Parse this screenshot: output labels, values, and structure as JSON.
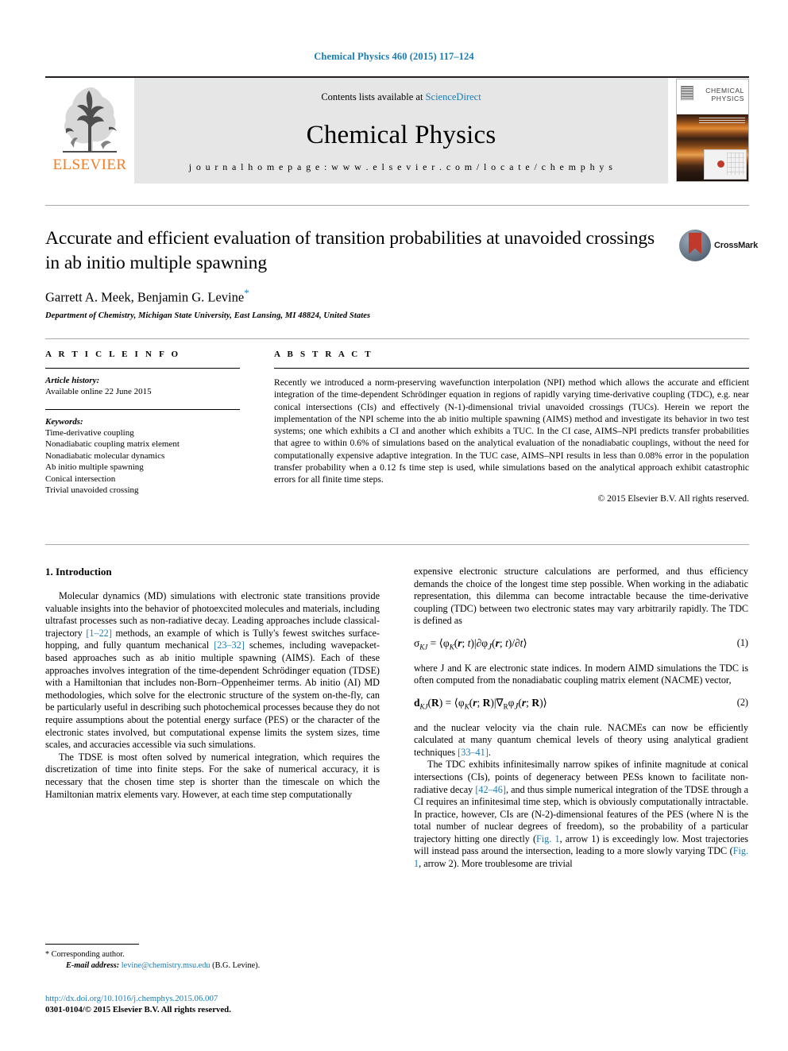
{
  "running_head": "Chemical Physics 460 (2015) 117–124",
  "masthead": {
    "publisher_logo_text": "ELSEVIER",
    "contents_prefix": "Contents lists available at ",
    "contents_link": "ScienceDirect",
    "journal_title": "Chemical Physics",
    "homepage_line": "j o u r n a l   h o m e p a g e :   w w w . e l s e v i e r . c o m / l o c a t e / c h e m p h y s",
    "cover_title_line1": "CHEMICAL",
    "cover_title_line2": "PHYSICS"
  },
  "article": {
    "title": "Accurate and efficient evaluation of transition probabilities at unavoided crossings in ab initio multiple spawning",
    "authors": "Garrett A. Meek, Benjamin G. Levine",
    "corresponding_marker": "*",
    "affiliation": "Department of Chemistry, Michigan State University, East Lansing, MI 48824, United States",
    "crossmark_label": "CrossMark"
  },
  "info": {
    "heading": "A R T I C L E   I N F O",
    "history_label": "Article history:",
    "history_value": "Available online 22 June 2015",
    "keywords_label": "Keywords:",
    "keywords": [
      "Time-derivative coupling",
      "Nonadiabatic coupling matrix element",
      "Nonadiabatic molecular dynamics",
      "Ab initio multiple spawning",
      "Conical intersection",
      "Trivial unavoided crossing"
    ]
  },
  "abstract": {
    "heading": "A B S T R A C T",
    "text": "Recently we introduced a norm-preserving wavefunction interpolation (NPI) method which allows the accurate and efficient integration of the time-dependent Schrödinger equation in regions of rapidly varying time-derivative coupling (TDC), e.g. near conical intersections (CIs) and effectively (N-1)-dimensional trivial unavoided crossings (TUCs). Herein we report the implementation of the NPI scheme into the ab initio multiple spawning (AIMS) method and investigate its behavior in two test systems; one which exhibits a CI and another which exhibits a TUC. In the CI case, AIMS–NPI predicts transfer probabilities that agree to within 0.6% of simulations based on the analytical evaluation of the nonadiabatic couplings, without the need for computationally expensive adaptive integration. In the TUC case, AIMS–NPI results in less than 0.08% error in the population transfer probability when a 0.12 fs time step is used, while simulations based on the analytical approach exhibit catastrophic errors for all finite time steps.",
    "copyright": "© 2015 Elsevier B.V. All rights reserved."
  },
  "body": {
    "section_heading": "1. Introduction",
    "left_paragraphs": [
      {
        "parts": [
          {
            "t": "Molecular dynamics (MD) simulations with electronic state transitions provide valuable insights into the behavior of photoexcited molecules and materials, including ultrafast processes such as non-radiative decay. Leading approaches include classical-trajectory "
          },
          {
            "t": "[1–22]",
            "ref": true
          },
          {
            "t": " methods, an example of which is Tully's fewest switches surface-hopping, and fully quantum mechanical "
          },
          {
            "t": "[23–32]",
            "ref": true
          },
          {
            "t": " schemes, including wavepacket-based approaches such as ab initio multiple spawning (AIMS). Each of these approaches involves integration of the time-dependent Schrödinger equation (TDSE) with a Hamiltonian that includes non-Born–Oppenheimer terms. Ab initio (AI) MD methodologies, which solve for the electronic structure of the system on-the-fly, can be particularly useful in describing such photochemical processes because they do not require assumptions about the potential energy surface (PES) or the character of the electronic states involved, but computational expense limits the system sizes, time scales, and accuracies accessible via such simulations."
          }
        ]
      },
      {
        "parts": [
          {
            "t": "The TDSE is most often solved by numerical integration, which requires the discretization of time into finite steps. For the sake of numerical accuracy, it is necessary that the chosen time step is shorter than the timescale on which the Hamiltonian matrix elements vary. However, at each time step computationally"
          }
        ]
      }
    ],
    "right_paragraphs": [
      {
        "parts": [
          {
            "t": "expensive electronic structure calculations are performed, and thus efficiency demands the choice of the longest time step possible. When working in the adiabatic representation, this dilemma can become intractable because the time-derivative coupling (TDC) between two electronic states may vary arbitrarily rapidly. The TDC is defined as"
          }
        ],
        "noindent": true
      },
      {
        "parts": [
          {
            "t": "where J and K are electronic state indices. In modern AIMD simulations the TDC is often computed from the nonadiabatic coupling matrix element (NACME) vector,"
          }
        ],
        "noindent": true
      },
      {
        "parts": [
          {
            "t": "and the nuclear velocity via the chain rule. NACMEs can now be efficiently calculated at many quantum chemical levels of theory using analytical gradient techniques "
          },
          {
            "t": "[33–41]",
            "ref": true
          },
          {
            "t": "."
          }
        ],
        "noindent": true
      },
      {
        "parts": [
          {
            "t": "The TDC exhibits infinitesimally narrow spikes of infinite magnitude at conical intersections (CIs), points of degeneracy between PESs known to facilitate non-radiative decay "
          },
          {
            "t": "[42–46]",
            "ref": true
          },
          {
            "t": ", and thus simple numerical integration of the TDSE through a CI requires an infinitesimal time step, which is obviously computationally intractable. In practice, however, CIs are (N-2)-dimensional features of the PES (where N is the total number of nuclear degrees of freedom), so the probability of a particular trajectory hitting one directly ("
          },
          {
            "t": "Fig. 1",
            "ref": true
          },
          {
            "t": ", arrow 1) is exceedingly low. Most trajectories will instead pass around the intersection, leading to a more slowly varying TDC ("
          },
          {
            "t": "Fig. 1",
            "ref": true
          },
          {
            "t": ", arrow 2). More troublesome are trivial"
          }
        ]
      }
    ],
    "equation_1_number": "(1)",
    "equation_2_number": "(2)"
  },
  "footer": {
    "corresponding_star": "*",
    "corresponding_label": "Corresponding author.",
    "email_label": "E-mail address:",
    "email": "levine@chemistry.msu.edu",
    "email_owner": "(B.G. Levine).",
    "doi": "http://dx.doi.org/10.1016/j.chemphys.2015.06.007",
    "issn_line": "0301-0104/© 2015 Elsevier B.V. All rights reserved."
  },
  "colors": {
    "link": "#1a7db6",
    "elsevier_orange": "#f47b20",
    "masthead_grey": "#e6e6e6"
  }
}
